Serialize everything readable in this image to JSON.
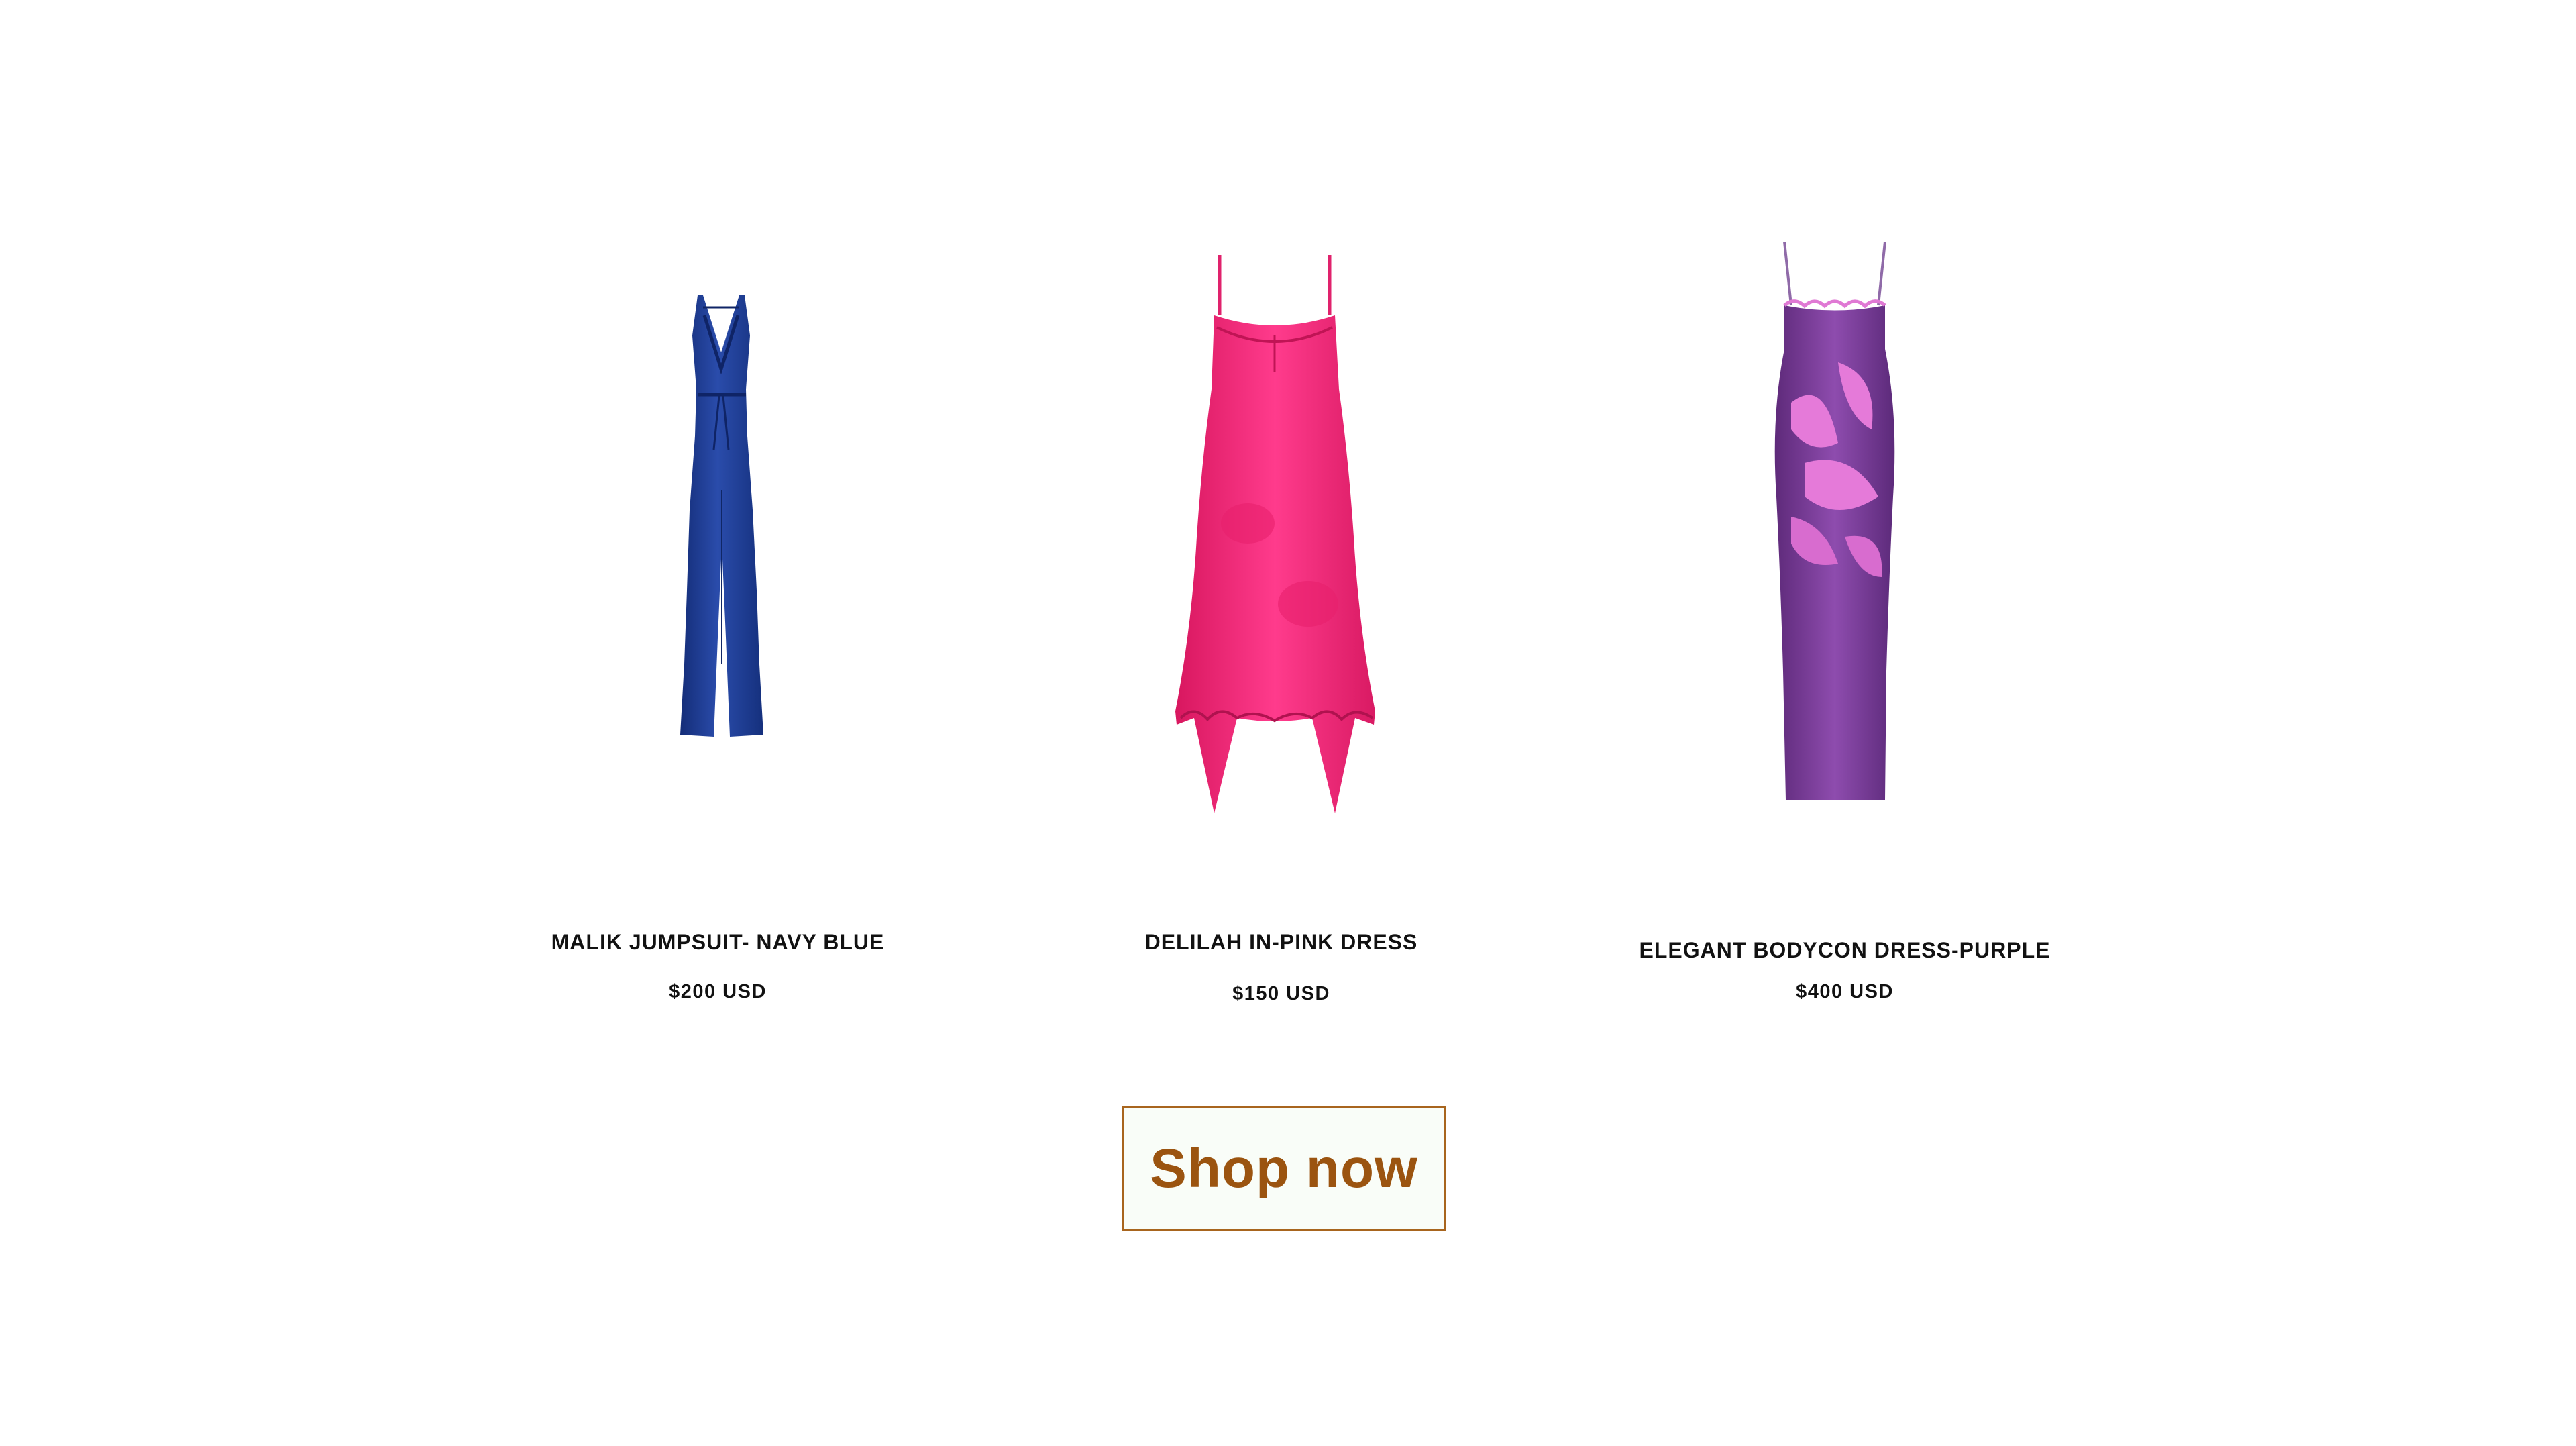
{
  "products": [
    {
      "name": "MALIK JUMPSUIT- NAVY BLUE",
      "price": "$200 USD",
      "image": "navy-jumpsuit",
      "color": "#1f3f98"
    },
    {
      "name": "DELILAH IN-PINK DRESS",
      "price": "$150 USD",
      "image": "pink-midi-dress",
      "color": "#f0267a"
    },
    {
      "name": "ELEGANT BODYCON DRESS-PURPLE",
      "price": "$400 USD",
      "image": "purple-floral-maxi-dress",
      "color": "#7a3f98"
    }
  ],
  "cta": {
    "label": "Shop now",
    "text_color": "#9b5410",
    "border_color": "#a8651e"
  }
}
